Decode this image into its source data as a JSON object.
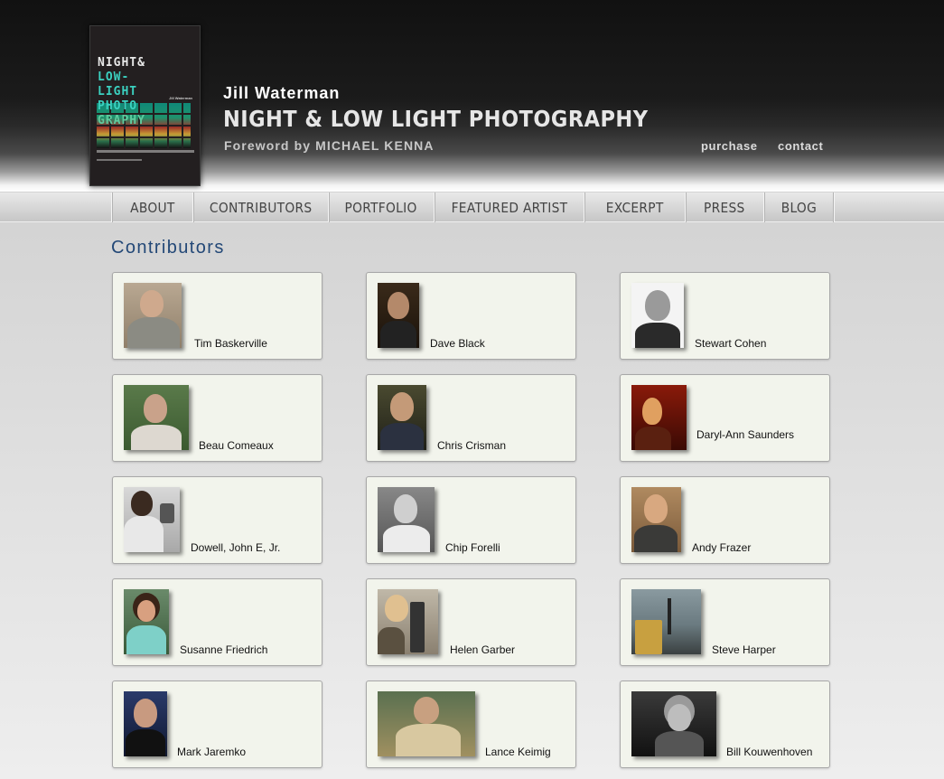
{
  "header": {
    "book_cover": {
      "title_lines": [
        "NIGHT&",
        "LOW-",
        "LIGHT",
        "PHOTO",
        "GRAPHY"
      ],
      "author": "Jill Waterman"
    },
    "author": "Jill Waterman",
    "title": "NIGHT & LOW LIGHT PHOTOGRAPHY",
    "foreword": "Foreword by MICHAEL KENNA",
    "links": {
      "purchase": "purchase",
      "contact": "contact"
    }
  },
  "nav": {
    "items": [
      "ABOUT",
      "CONTRIBUTORS",
      "PORTFOLIO",
      "FEATURED ARTIST",
      "EXCERPT",
      "PRESS",
      "BLOG"
    ]
  },
  "page": {
    "heading": "Contributors"
  },
  "contributors": [
    "Tim Baskerville",
    "Dave Black",
    "Stewart Cohen",
    "Beau Comeaux",
    "Chris Crisman",
    "Daryl-Ann Saunders",
    "Dowell, John E, Jr.",
    "Chip Forelli",
    "Andy Frazer",
    "Susanne Friedrich",
    "Helen Garber",
    "Steve Harper",
    "Mark Jaremko",
    "Lance Keimig",
    "Bill Kouwenhoven"
  ]
}
